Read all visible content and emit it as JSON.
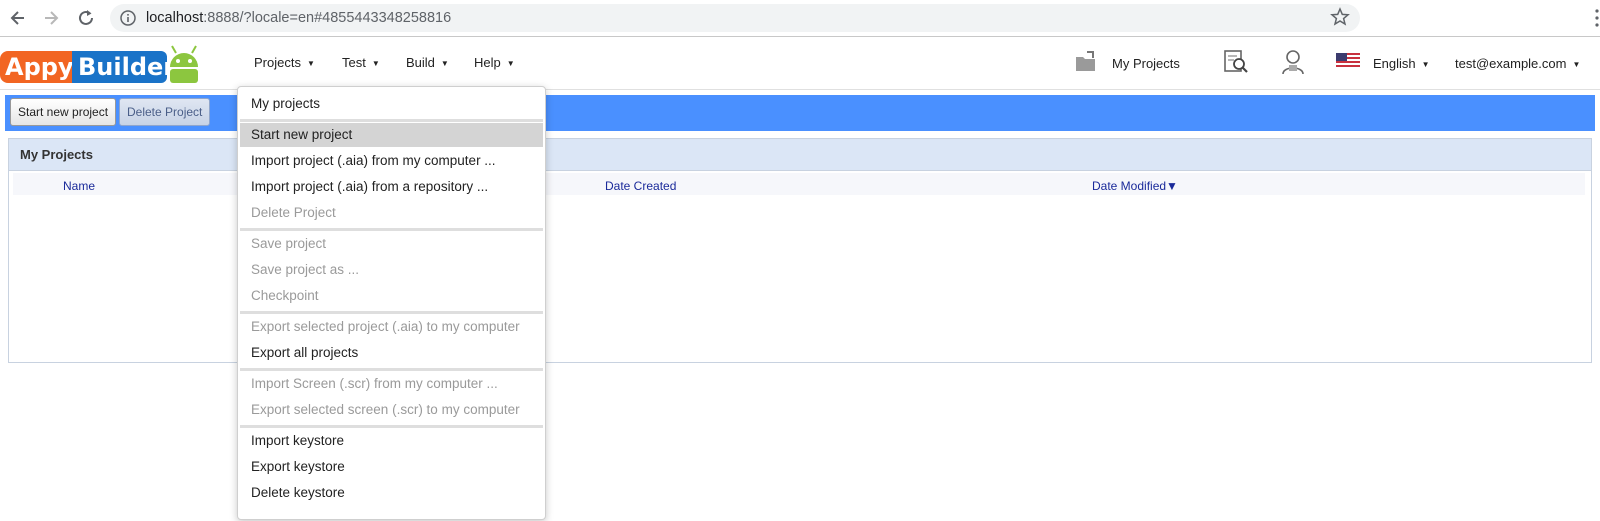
{
  "browser": {
    "url_host": "localhost",
    "url_rest": ":8888/?locale=en#4855443348258816"
  },
  "logo": {
    "part1": "Appy",
    "part2": "Builder"
  },
  "topnav": {
    "projects": "Projects",
    "test": "Test",
    "build": "Build",
    "help": "Help"
  },
  "header_right": {
    "my_projects": "My Projects",
    "language": "English",
    "user": "test@example.com"
  },
  "toolbar": {
    "start_new_project": "Start new project",
    "delete_project": "Delete Project"
  },
  "panel": {
    "title": "My Projects",
    "columns": [
      "Name",
      "Date Created",
      "Date Modified▼"
    ]
  },
  "projects_menu": {
    "items": [
      {
        "label": "My projects",
        "enabled": true
      },
      {
        "label": "Start new project",
        "enabled": true,
        "highlighted": true
      },
      {
        "label": "Import project (.aia) from my computer ...",
        "enabled": true
      },
      {
        "label": "Import project (.aia) from a repository ...",
        "enabled": true
      },
      {
        "label": "Delete Project",
        "enabled": false
      },
      {
        "label": "Save project",
        "enabled": false
      },
      {
        "label": "Save project as ...",
        "enabled": false
      },
      {
        "label": "Checkpoint",
        "enabled": false
      },
      {
        "label": "Export selected project (.aia) to my computer",
        "enabled": false
      },
      {
        "label": "Export all projects",
        "enabled": true
      },
      {
        "label": "Import Screen (.scr) from my computer ...",
        "enabled": false
      },
      {
        "label": "Export selected screen (.scr) to my computer",
        "enabled": false
      },
      {
        "label": "Import keystore",
        "enabled": true
      },
      {
        "label": "Export keystore",
        "enabled": true
      },
      {
        "label": "Delete keystore",
        "enabled": true
      }
    ]
  },
  "colors": {
    "toolbar": "#4a90ff",
    "logo_orange": "#f26522",
    "logo_blue": "#1a73c8",
    "panel_header": "#dbe6f6",
    "column_link": "#1a2a9a"
  }
}
